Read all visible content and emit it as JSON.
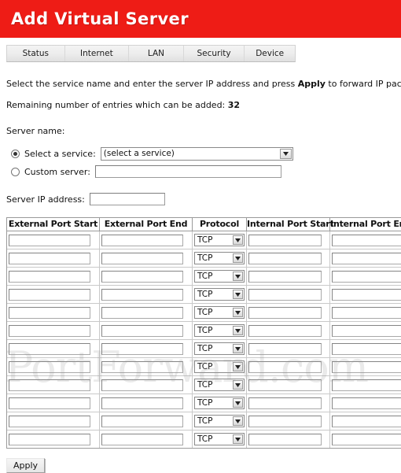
{
  "banner": {
    "title": "Add Virtual Server",
    "bg_color": "#ee1c16",
    "text_color": "#ffffff"
  },
  "tabs": [
    {
      "label": "Status"
    },
    {
      "label": "Internet"
    },
    {
      "label": "LAN"
    },
    {
      "label": "Security"
    },
    {
      "label": "Device"
    }
  ],
  "intro": {
    "part1": "Select the service name and enter the server IP address and press ",
    "emphasis": "Apply",
    "part2": " to forward IP pack",
    "remaining_text": "Remaining number of entries which can be added: ",
    "remaining_count": "32"
  },
  "form": {
    "server_name_label": "Server name:",
    "select_service_label": "Select a service:",
    "select_service_value": "(select a service)",
    "select_service_checked": true,
    "custom_server_label": "Custom server:",
    "custom_server_value": "",
    "custom_server_checked": false,
    "server_ip_label": "Server IP address:",
    "server_ip_value": ""
  },
  "table": {
    "headers": [
      "External Port Start",
      "External Port End",
      "Protocol",
      "Internal Port Start",
      "Internal Port End"
    ],
    "protocol_value": "TCP",
    "rows": [
      {
        "external_port_start": "",
        "external_port_end": "",
        "protocol": "TCP",
        "internal_port_start": "",
        "internal_port_end": ""
      },
      {
        "external_port_start": "",
        "external_port_end": "",
        "protocol": "TCP",
        "internal_port_start": "",
        "internal_port_end": ""
      },
      {
        "external_port_start": "",
        "external_port_end": "",
        "protocol": "TCP",
        "internal_port_start": "",
        "internal_port_end": ""
      },
      {
        "external_port_start": "",
        "external_port_end": "",
        "protocol": "TCP",
        "internal_port_start": "",
        "internal_port_end": ""
      },
      {
        "external_port_start": "",
        "external_port_end": "",
        "protocol": "TCP",
        "internal_port_start": "",
        "internal_port_end": ""
      },
      {
        "external_port_start": "",
        "external_port_end": "",
        "protocol": "TCP",
        "internal_port_start": "",
        "internal_port_end": ""
      },
      {
        "external_port_start": "",
        "external_port_end": "",
        "protocol": "TCP",
        "internal_port_start": "",
        "internal_port_end": ""
      },
      {
        "external_port_start": "",
        "external_port_end": "",
        "protocol": "TCP",
        "internal_port_start": "",
        "internal_port_end": ""
      },
      {
        "external_port_start": "",
        "external_port_end": "",
        "protocol": "TCP",
        "internal_port_start": "",
        "internal_port_end": ""
      },
      {
        "external_port_start": "",
        "external_port_end": "",
        "protocol": "TCP",
        "internal_port_start": "",
        "internal_port_end": ""
      },
      {
        "external_port_start": "",
        "external_port_end": "",
        "protocol": "TCP",
        "internal_port_start": "",
        "internal_port_end": ""
      },
      {
        "external_port_start": "",
        "external_port_end": "",
        "protocol": "TCP",
        "internal_port_start": "",
        "internal_port_end": ""
      }
    ]
  },
  "actions": {
    "apply_label": "Apply"
  },
  "watermark": {
    "text": "PortForward.com"
  }
}
